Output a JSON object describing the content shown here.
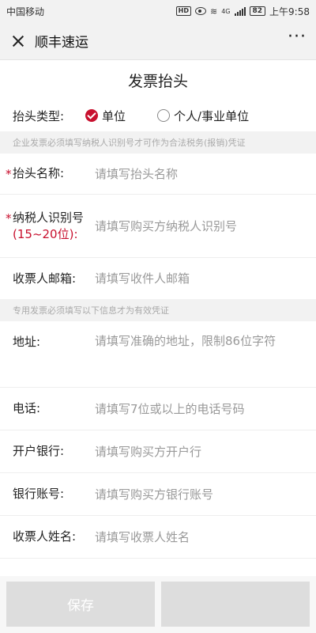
{
  "status_bar": {
    "carrier": "中国移动",
    "hd": "HD",
    "network": "4G",
    "battery": "82",
    "time": "上午9:58"
  },
  "nav": {
    "title": "顺丰速运",
    "more": "···"
  },
  "page_title": "发票抬头",
  "invoice_type": {
    "label": "抬头类型:",
    "options": [
      {
        "label": "单位",
        "selected": true
      },
      {
        "label": "个人/事业单位",
        "selected": false
      }
    ]
  },
  "hint_company": "企业发票必须填写纳税人识别号才可作为合法税务(报销)凭证",
  "hint_special": "专用发票必须填写以下信息才为有效凭证",
  "fields": {
    "title_name": {
      "required": "*",
      "label": "抬头名称:",
      "placeholder": "请填写抬头名称"
    },
    "tax_id": {
      "required": "*",
      "label": "纳税人识别号",
      "sublabel": "(15~20位):",
      "placeholder": "请填写购买方纳税人识别号"
    },
    "email": {
      "label": "收票人邮箱:",
      "placeholder": "请填写收件人邮箱"
    },
    "address": {
      "label": "地址:",
      "placeholder": "请填写准确的地址，限制86位字符"
    },
    "phone": {
      "label": "电话:",
      "placeholder": "请填写7位或以上的电话号码"
    },
    "bank": {
      "label": "开户银行:",
      "placeholder": "请填写购买方开户行"
    },
    "account": {
      "label": "银行账号:",
      "placeholder": "请填写购买方银行账号"
    },
    "receiver": {
      "label": "收票人姓名:",
      "placeholder": "请填写收票人姓名"
    }
  },
  "buttons": {
    "save": "保存",
    "submit": ""
  },
  "colors": {
    "accent": "#c8102e",
    "disabled_button": "#dddddd",
    "hint_bg": "#f2f2f2"
  }
}
